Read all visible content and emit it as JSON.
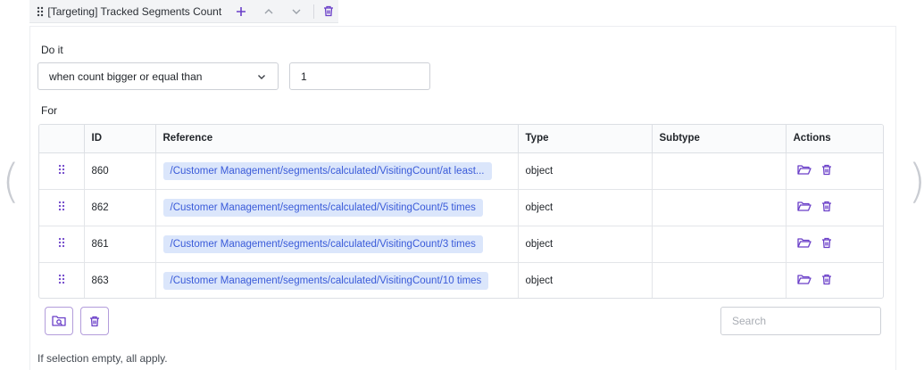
{
  "brackets": {
    "left": "(",
    "right": ")"
  },
  "tab": {
    "title": "[Targeting] Tracked Segments Count"
  },
  "form": {
    "do_it_label": "Do it",
    "condition_value": "when count bigger or equal than",
    "count_value": "1",
    "for_label": "For"
  },
  "table": {
    "columns": [
      "",
      "ID",
      "Reference",
      "Type",
      "Subtype",
      "Actions"
    ],
    "rows": [
      {
        "id": "860",
        "reference": "/Customer Management/segments/calculated/VisitingCount/at least...",
        "type": "object",
        "subtype": ""
      },
      {
        "id": "862",
        "reference": "/Customer Management/segments/calculated/VisitingCount/5 times",
        "type": "object",
        "subtype": ""
      },
      {
        "id": "861",
        "reference": "/Customer Management/segments/calculated/VisitingCount/3 times",
        "type": "object",
        "subtype": ""
      },
      {
        "id": "863",
        "reference": "/Customer Management/segments/calculated/VisitingCount/10 times",
        "type": "object",
        "subtype": ""
      }
    ]
  },
  "search": {
    "placeholder": "Search"
  },
  "footer": {
    "hint": "If selection empty, all apply."
  },
  "colors": {
    "accent": "#6a3fc8",
    "reference_bg": "#dbe6fb",
    "reference_text": "#3a5bd9",
    "border": "#dcdfe4"
  }
}
